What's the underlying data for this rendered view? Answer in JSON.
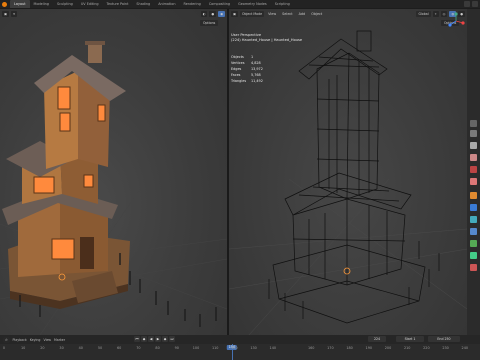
{
  "topbar": {
    "tabs": [
      "Layout",
      "Modeling",
      "Sculpting",
      "UV Editing",
      "Texture Paint",
      "Shading",
      "Animation",
      "Rendering",
      "Compositing",
      "Geometry Nodes",
      "Scripting"
    ],
    "active_tab": "Layout"
  },
  "left_viewport": {
    "options_label": "Options"
  },
  "right_viewport": {
    "mode_label": "Object Mode",
    "menus": [
      "View",
      "Select",
      "Add",
      "Object"
    ],
    "transform_label": "Global",
    "options_label": "Options",
    "view_name": "User Perspective",
    "collection_line": "(224) Haunted_House | Haunted_House",
    "stats": [
      {
        "label": "Objects",
        "value": "1"
      },
      {
        "label": "Vertices",
        "value": "4,828"
      },
      {
        "label": "Edges",
        "value": "13,972"
      },
      {
        "label": "Faces",
        "value": "5,768"
      },
      {
        "label": "Triangles",
        "value": "11,492"
      }
    ]
  },
  "timeline": {
    "menus": [
      "Playback",
      "Keying",
      "View",
      "Marker"
    ],
    "current_frame": "224",
    "start_label": "Start",
    "start_value": "1",
    "end_label": "End",
    "end_value": "250",
    "ticks": [
      "0",
      "10",
      "20",
      "30",
      "40",
      "50",
      "60",
      "70",
      "80",
      "90",
      "100",
      "110",
      "120",
      "130",
      "140",
      "150",
      "160",
      "170",
      "180",
      "190",
      "200",
      "210",
      "220",
      "230",
      "240",
      "250"
    ],
    "playhead_frame": "150"
  },
  "colors": {
    "accent": "#4772b3",
    "logo": "#e87d0d",
    "window_glow": "#ff8a3d"
  }
}
